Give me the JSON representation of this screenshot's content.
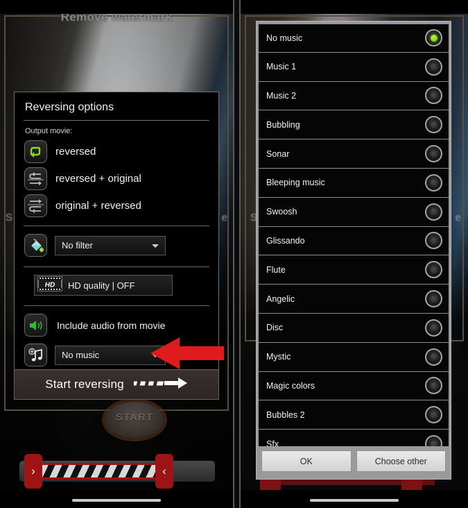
{
  "left_phone": {
    "wallpaper_text": "Remove watermark",
    "start_knob_label": "START",
    "dialog": {
      "title": "Reversing options",
      "output_label": "Output movie:",
      "options": [
        {
          "label": "reversed",
          "icon": "reverse-loop-icon",
          "selected": true
        },
        {
          "label": "reversed + original",
          "icon": "reverse-then-original-icon",
          "selected": false
        },
        {
          "label": "original + reversed",
          "icon": "original-then-reverse-icon",
          "selected": false
        }
      ],
      "filter": {
        "icon": "paint-bucket-icon",
        "value": "No filter"
      },
      "hd": {
        "icon": "hd-film-icon",
        "value": "HD quality | OFF"
      },
      "audio": {
        "icon": "speaker-icon",
        "label": "Include audio from movie"
      },
      "music": {
        "icon": "add-music-icon",
        "value": "No music"
      },
      "start_button": "Start reversing"
    },
    "annotation": {
      "arrow_color": "#e01b1b",
      "points_to": "No music"
    }
  },
  "right_phone": {
    "picker": {
      "items": [
        {
          "label": "No music",
          "selected": true
        },
        {
          "label": "Music 1",
          "selected": false
        },
        {
          "label": "Music 2",
          "selected": false
        },
        {
          "label": "Bubbling",
          "selected": false
        },
        {
          "label": "Sonar",
          "selected": false
        },
        {
          "label": "Bleeping music",
          "selected": false
        },
        {
          "label": "Swoosh",
          "selected": false
        },
        {
          "label": "Glissando",
          "selected": false
        },
        {
          "label": "Flute",
          "selected": false
        },
        {
          "label": "Angelic",
          "selected": false
        },
        {
          "label": "Disc",
          "selected": false
        },
        {
          "label": "Mystic",
          "selected": false
        },
        {
          "label": "Magic colors",
          "selected": false
        },
        {
          "label": "Bubbles 2",
          "selected": false
        },
        {
          "label": "Sfx",
          "selected": false
        }
      ],
      "buttons": {
        "ok": "OK",
        "choose_other": "Choose other"
      }
    }
  },
  "colors": {
    "accent_green": "#8ddb2a",
    "annotation_red": "#e01b1b",
    "handle_red": "#9e1414",
    "dialog_bg": "#000000",
    "picker_chrome": "#9a9a9a"
  }
}
